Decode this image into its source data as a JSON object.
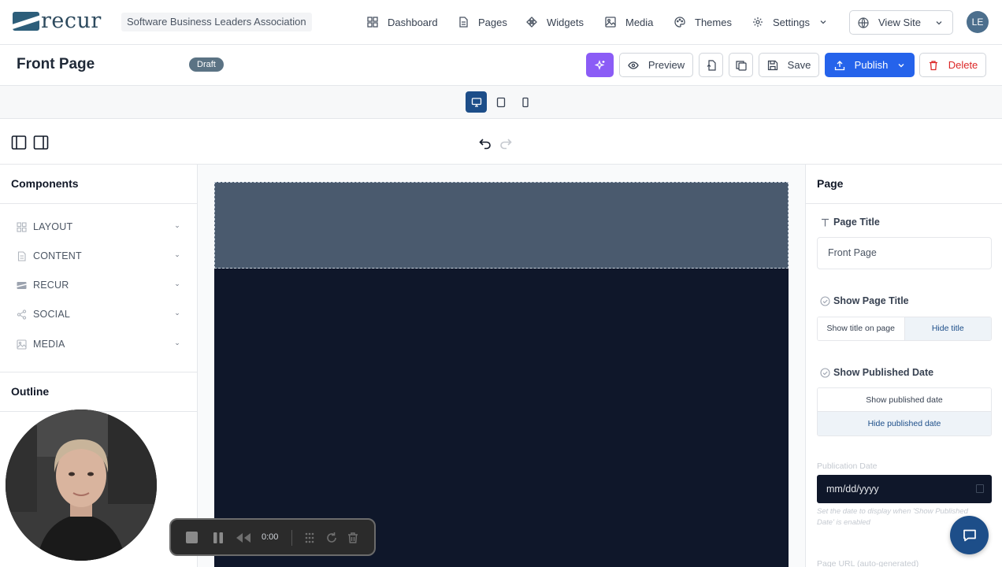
{
  "brand": {
    "logo_text": "recur",
    "org_name": "Software Business Leaders Association"
  },
  "nav": {
    "items": [
      {
        "label": "Dashboard",
        "icon": "grid-icon"
      },
      {
        "label": "Pages",
        "icon": "document-icon"
      },
      {
        "label": "Widgets",
        "icon": "widget-icon"
      },
      {
        "label": "Media",
        "icon": "image-icon"
      },
      {
        "label": "Themes",
        "icon": "palette-icon"
      },
      {
        "label": "Settings",
        "icon": "gear-icon"
      }
    ],
    "view_site": "View Site",
    "avatar_initials": "LE"
  },
  "page": {
    "title": "Front Page",
    "status": "Draft"
  },
  "actions": {
    "preview": "Preview",
    "save": "Save",
    "publish": "Publish",
    "delete": "Delete"
  },
  "devices": {
    "active": "desktop",
    "options": [
      "desktop",
      "tablet",
      "mobile"
    ]
  },
  "components": {
    "title": "Components",
    "categories": [
      {
        "label": "LAYOUT",
        "icon": "layout-icon"
      },
      {
        "label": "CONTENT",
        "icon": "content-icon"
      },
      {
        "label": "RECUR",
        "icon": "recur-icon"
      },
      {
        "label": "SOCIAL",
        "icon": "share-icon"
      },
      {
        "label": "MEDIA",
        "icon": "image-icon"
      }
    ]
  },
  "outline": {
    "title": "Outline"
  },
  "panel": {
    "title": "Page",
    "page_title_label": "Page Title",
    "page_title_value": "Front Page",
    "show_title_label": "Show Page Title",
    "show_title_options": [
      "Show title on page",
      "Hide title"
    ],
    "show_title_selected": "Hide title",
    "show_date_label": "Show Published Date",
    "show_date_options": [
      "Show published date",
      "Hide published date"
    ],
    "show_date_selected": "Hide published date",
    "pub_date_label": "Publication Date",
    "pub_date_placeholder": "mm/dd/yyyy",
    "pub_date_hint": "Set the date to display when 'Show Published Date' is enabled",
    "url_label": "Page URL (auto-generated)"
  },
  "recorder": {
    "time": "0:00"
  },
  "colors": {
    "accent": "#2563eb",
    "ai_button": "#8b5cf6",
    "draft_badge": "#5b7384",
    "danger": "#dc2626",
    "canvas_header": "#4a5a6e",
    "canvas_body": "#0f172a",
    "selected_toggle": "#1d4e89"
  }
}
